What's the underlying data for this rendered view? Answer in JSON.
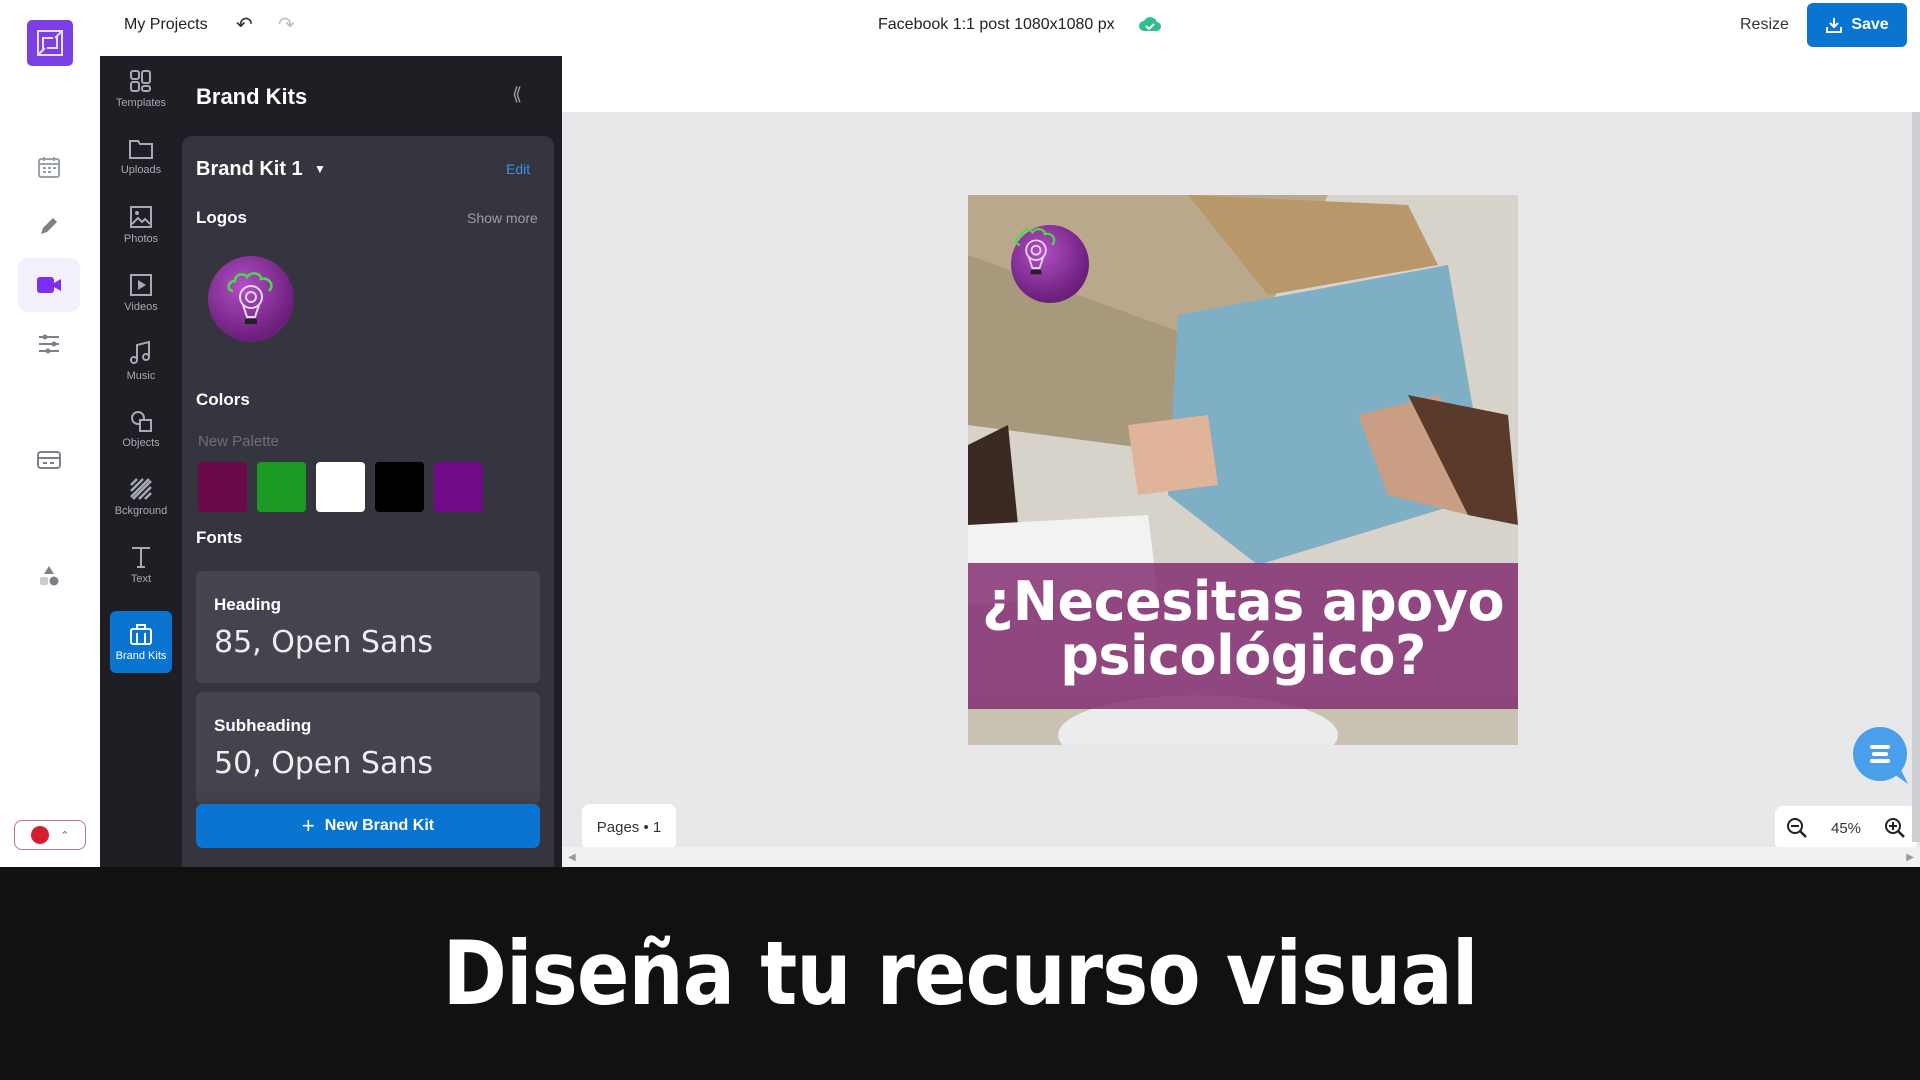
{
  "topbar": {
    "my_projects": "My Projects",
    "document_title": "Facebook 1:1 post 1080x1080 px",
    "resize_label": "Resize",
    "save_label": "Save",
    "sync_status_icon": "cloud-check-icon"
  },
  "rail": {
    "items": [
      {
        "icon": "calendar-icon"
      },
      {
        "icon": "pencil-icon"
      },
      {
        "icon": "video-camera-icon",
        "active": true
      },
      {
        "icon": "sliders-icon"
      },
      {
        "icon": "card-icon"
      },
      {
        "icon": "shapes-icon"
      }
    ],
    "record_color": "#d21f30"
  },
  "tools": [
    {
      "label": "Templates",
      "icon": "templates-icon"
    },
    {
      "label": "Uploads",
      "icon": "folder-icon"
    },
    {
      "label": "Photos",
      "icon": "photo-icon"
    },
    {
      "label": "Videos",
      "icon": "video-icon"
    },
    {
      "label": "Music",
      "icon": "music-icon"
    },
    {
      "label": "Objects",
      "icon": "objects-icon"
    },
    {
      "label": "Bckground",
      "icon": "background-icon"
    },
    {
      "label": "Text",
      "icon": "text-icon"
    },
    {
      "label": "Brand Kits",
      "icon": "briefcase-icon",
      "active": true
    }
  ],
  "panel": {
    "title": "Brand Kits",
    "kit_name": "Brand Kit 1",
    "edit_label": "Edit",
    "logos_label": "Logos",
    "show_more_label": "Show more",
    "colors_label": "Colors",
    "palette_name": "New Palette",
    "colors": [
      "#6a0a4a",
      "#1a9a22",
      "#ffffff",
      "#000000",
      "#700a88"
    ],
    "fonts_label": "Fonts",
    "fonts": [
      {
        "label": "Heading",
        "value": "85, Open Sans"
      },
      {
        "label": "Subheading",
        "value": "50, Open Sans"
      }
    ],
    "new_kit_label": "New Brand Kit"
  },
  "canvas": {
    "design_headline_line1": "¿Necesitas apoyo",
    "design_headline_line2": "psicológico?",
    "pages_label": "Pages • 1",
    "zoom_level": "45%"
  },
  "caption": {
    "text": "Diseña tu recurso visual"
  }
}
